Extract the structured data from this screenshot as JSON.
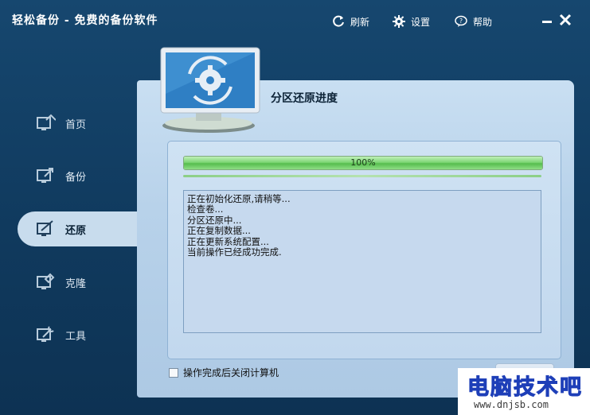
{
  "app": {
    "title": "轻松备份 - 免费的备份软件"
  },
  "toolbar": {
    "refresh_label": "刷新",
    "settings_label": "设置",
    "help_label": "帮助"
  },
  "sidebar": {
    "items": [
      {
        "label": "首页",
        "icon": "home-icon"
      },
      {
        "label": "备份",
        "icon": "backup-icon"
      },
      {
        "label": "还原",
        "icon": "restore-icon",
        "active": true
      },
      {
        "label": "克隆",
        "icon": "clone-icon"
      },
      {
        "label": "工具",
        "icon": "tools-icon"
      }
    ]
  },
  "main": {
    "title": "分区还原进度",
    "progress": {
      "value": 1.0,
      "label": "100%"
    },
    "log_lines": [
      "正在初始化还原,请稍等...",
      "检查卷...",
      "分区还原中...",
      "正在复制数据...",
      "正在更新系统配置...",
      "当前操作已经成功完成."
    ],
    "shutdown_checkbox": {
      "label": "操作完成后关闭计算机",
      "checked": false
    }
  },
  "watermark": {
    "main": "电脑技术吧",
    "sub": "www.dnjsb.com"
  },
  "colors": {
    "background": "#103a5e",
    "panel": "#b8d2ea",
    "progress_fill": "#56bd4e",
    "active_nav": "#c8dced"
  }
}
